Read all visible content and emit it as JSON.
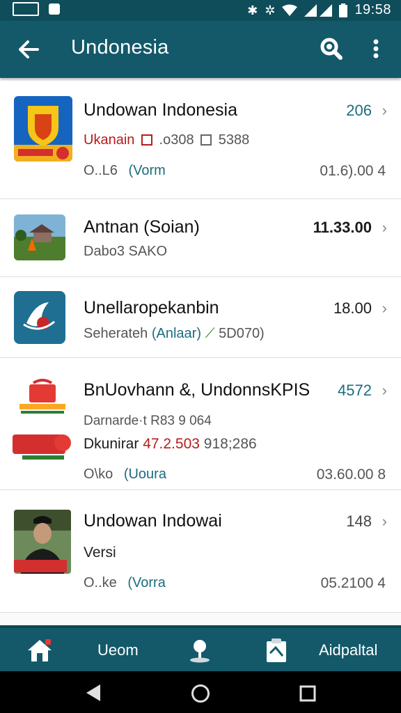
{
  "status_bar": {
    "time": "19:58",
    "icons": [
      "gallery-icon",
      "message-icon",
      "bluetooth-icon",
      "nfc-icon",
      "wifi-icon",
      "signal-icon",
      "battery-icon"
    ]
  },
  "app_bar": {
    "title": "Undonesia",
    "back_icon": "back-arrow-icon",
    "search_icon": "search-icon",
    "more_icon": "more-vert-icon",
    "color": "#13596a"
  },
  "list": {
    "items": [
      {
        "title": "Undowan Indonesia",
        "value": "206",
        "line1_red": "Ukanain",
        "line1_rest": ".o308",
        "line1_extra": "5388",
        "line2_left": "O..L6",
        "line2_teal": "(Vorm",
        "line2_right": "01.6).00 4"
      },
      {
        "title": "Antnan (Soian)",
        "value": "11.33.00",
        "line1": "Dabo3 SAKO"
      },
      {
        "title": "Unellaropekanbin",
        "value": "18.00",
        "line1_left": "Seherateh",
        "line1_teal": "(Anlaar)",
        "line1_rest": "5D070)"
      },
      {
        "title": "BnUovhann &, UndonnsKPIS",
        "value": "4572",
        "line1": "Darnarde·t  R83 9 064",
        "line2_dark": "Dkunirar",
        "line2_red": "47.2.503",
        "line2_rest": "918;286",
        "line3_left": "O\\ko",
        "line3_teal": "(Uoura",
        "line3_right": "03.60.00 8"
      },
      {
        "title": "Undowan Indowai",
        "value": "148",
        "line1": "Versi",
        "line2_left": "O..ke",
        "line2_teal": "(Vorra",
        "line2_right": "05.2100 4"
      }
    ]
  },
  "bottom_nav": {
    "items": [
      {
        "icon": "home-icon",
        "label": ""
      },
      {
        "icon": "",
        "label": "Ueom"
      },
      {
        "icon": "pin-icon",
        "label": ""
      },
      {
        "icon": "clipboard-icon",
        "label": ""
      },
      {
        "icon": "",
        "label": "Aidpaltal"
      }
    ]
  },
  "system_nav": {
    "back": "back-triangle-icon",
    "home": "home-circle-icon",
    "recents": "recents-square-icon"
  }
}
